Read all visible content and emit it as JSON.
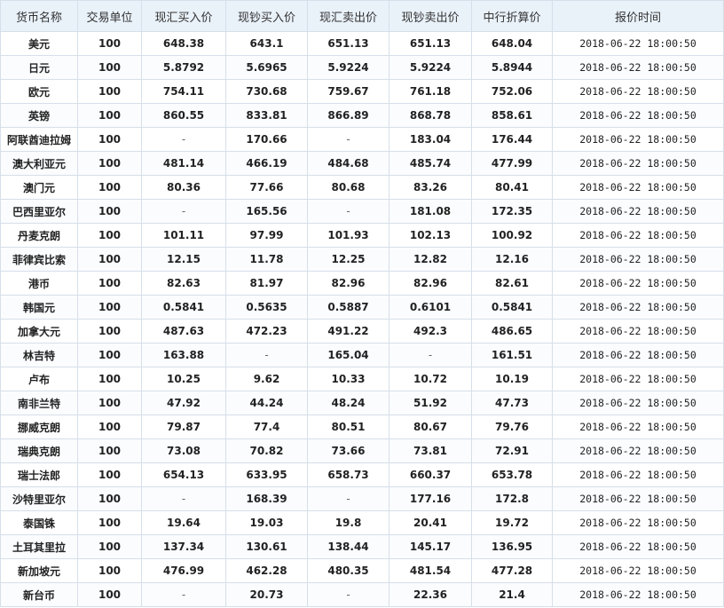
{
  "headers": [
    "货币名称",
    "交易单位",
    "现汇买入价",
    "现钞买入价",
    "现汇卖出价",
    "现钞卖出价",
    "中行折算价",
    "报价时间"
  ],
  "rows": [
    [
      "美元",
      "100",
      "648.38",
      "643.1",
      "651.13",
      "651.13",
      "648.04",
      "2018-06-22 18:00:50"
    ],
    [
      "日元",
      "100",
      "5.8792",
      "5.6965",
      "5.9224",
      "5.9224",
      "5.8944",
      "2018-06-22 18:00:50"
    ],
    [
      "欧元",
      "100",
      "754.11",
      "730.68",
      "759.67",
      "761.18",
      "752.06",
      "2018-06-22 18:00:50"
    ],
    [
      "英镑",
      "100",
      "860.55",
      "833.81",
      "866.89",
      "868.78",
      "858.61",
      "2018-06-22 18:00:50"
    ],
    [
      "阿联酋迪拉姆",
      "100",
      "-",
      "170.66",
      "-",
      "183.04",
      "176.44",
      "2018-06-22 18:00:50"
    ],
    [
      "澳大利亚元",
      "100",
      "481.14",
      "466.19",
      "484.68",
      "485.74",
      "477.99",
      "2018-06-22 18:00:50"
    ],
    [
      "澳门元",
      "100",
      "80.36",
      "77.66",
      "80.68",
      "83.26",
      "80.41",
      "2018-06-22 18:00:50"
    ],
    [
      "巴西里亚尔",
      "100",
      "-",
      "165.56",
      "-",
      "181.08",
      "172.35",
      "2018-06-22 18:00:50"
    ],
    [
      "丹麦克朗",
      "100",
      "101.11",
      "97.99",
      "101.93",
      "102.13",
      "100.92",
      "2018-06-22 18:00:50"
    ],
    [
      "菲律宾比索",
      "100",
      "12.15",
      "11.78",
      "12.25",
      "12.82",
      "12.16",
      "2018-06-22 18:00:50"
    ],
    [
      "港币",
      "100",
      "82.63",
      "81.97",
      "82.96",
      "82.96",
      "82.61",
      "2018-06-22 18:00:50"
    ],
    [
      "韩国元",
      "100",
      "0.5841",
      "0.5635",
      "0.5887",
      "0.6101",
      "0.5841",
      "2018-06-22 18:00:50"
    ],
    [
      "加拿大元",
      "100",
      "487.63",
      "472.23",
      "491.22",
      "492.3",
      "486.65",
      "2018-06-22 18:00:50"
    ],
    [
      "林吉特",
      "100",
      "163.88",
      "-",
      "165.04",
      "-",
      "161.51",
      "2018-06-22 18:00:50"
    ],
    [
      "卢布",
      "100",
      "10.25",
      "9.62",
      "10.33",
      "10.72",
      "10.19",
      "2018-06-22 18:00:50"
    ],
    [
      "南非兰特",
      "100",
      "47.92",
      "44.24",
      "48.24",
      "51.92",
      "47.73",
      "2018-06-22 18:00:50"
    ],
    [
      "挪威克朗",
      "100",
      "79.87",
      "77.4",
      "80.51",
      "80.67",
      "79.76",
      "2018-06-22 18:00:50"
    ],
    [
      "瑞典克朗",
      "100",
      "73.08",
      "70.82",
      "73.66",
      "73.81",
      "72.91",
      "2018-06-22 18:00:50"
    ],
    [
      "瑞士法郎",
      "100",
      "654.13",
      "633.95",
      "658.73",
      "660.37",
      "653.78",
      "2018-06-22 18:00:50"
    ],
    [
      "沙特里亚尔",
      "100",
      "-",
      "168.39",
      "-",
      "177.16",
      "172.8",
      "2018-06-22 18:00:50"
    ],
    [
      "泰国铢",
      "100",
      "19.64",
      "19.03",
      "19.8",
      "20.41",
      "19.72",
      "2018-06-22 18:00:50"
    ],
    [
      "土耳其里拉",
      "100",
      "137.34",
      "130.61",
      "138.44",
      "145.17",
      "136.95",
      "2018-06-22 18:00:50"
    ],
    [
      "新加坡元",
      "100",
      "476.99",
      "462.28",
      "480.35",
      "481.54",
      "477.28",
      "2018-06-22 18:00:50"
    ],
    [
      "新台币",
      "100",
      "-",
      "20.73",
      "-",
      "22.36",
      "21.4",
      "2018-06-22 18:00:50"
    ]
  ]
}
